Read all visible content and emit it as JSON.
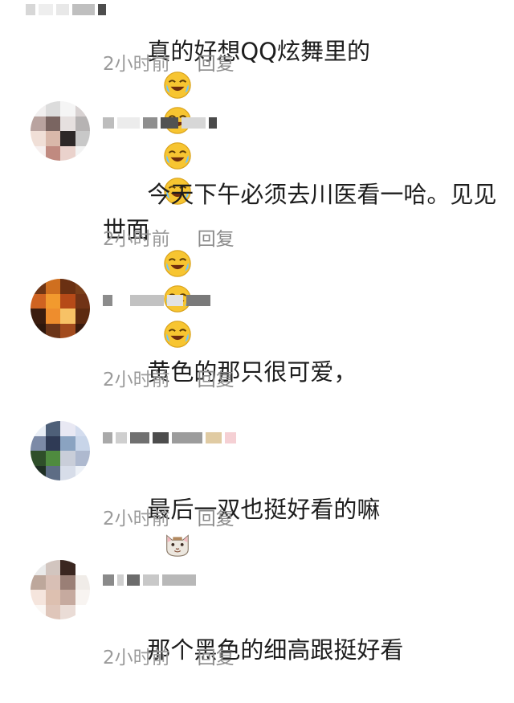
{
  "comments": [
    {
      "text": "真的好想QQ炫舞里的",
      "emoji_count": 4,
      "emoji": "laugh-cry-emoji",
      "time": "2小时前",
      "reply": "回复"
    },
    {
      "text": "今天下午必须去川医看一哈。见见世面",
      "emoji_count": 3,
      "emoji": "laugh-cry-emoji",
      "time": "2小时前",
      "reply": "回复"
    },
    {
      "text": "黄色的那只很可爱，",
      "emoji_count": 0,
      "time": "2小时前",
      "reply": "回复"
    },
    {
      "text": "最后一双也挺好看的嘛",
      "emoji_count": 1,
      "emoji": "cat-face-emoji",
      "time": "2小时前",
      "reply": "回复"
    },
    {
      "text": "那个黑色的细高跟挺好看",
      "emoji_count": 0,
      "time": "2小时前",
      "reply": "回复"
    }
  ],
  "colors": {
    "meta_text": "#9a9a9a",
    "body_text": "#1d1d1d",
    "emoji_yellow": "#f7c531",
    "tear_blue": "#6cc4ff"
  }
}
